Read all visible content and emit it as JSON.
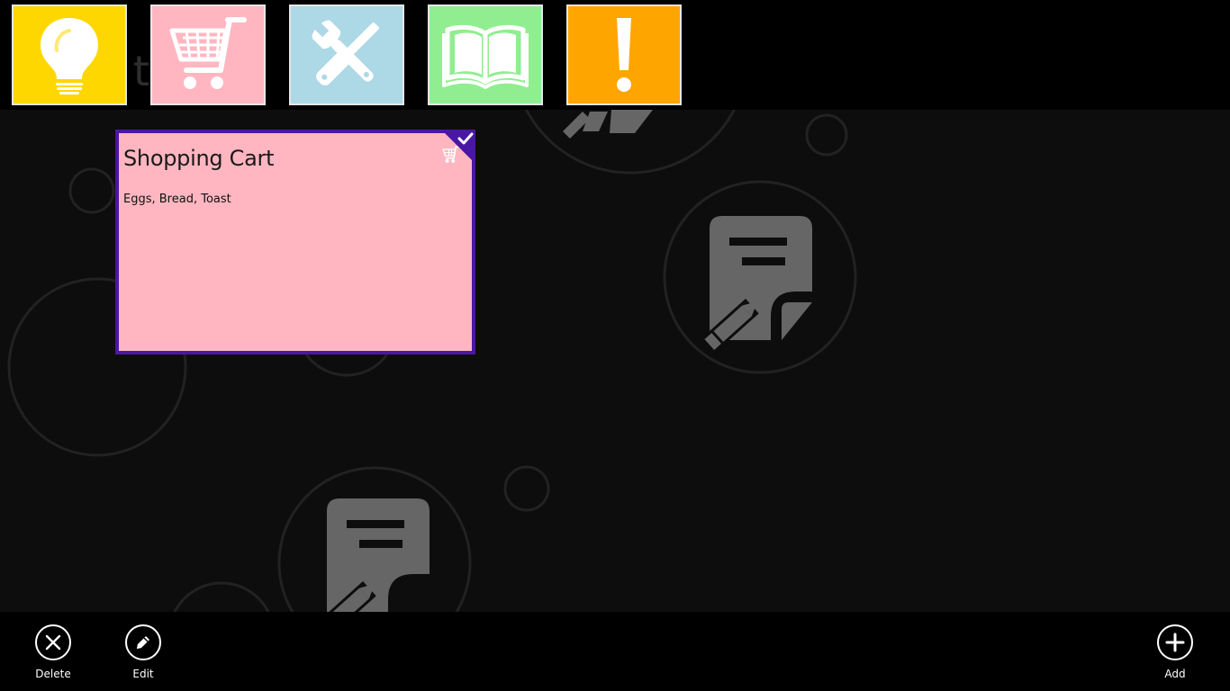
{
  "categories": [
    {
      "id": "idea",
      "icon": "lightbulb-icon",
      "color": "#ffd700"
    },
    {
      "id": "shopping",
      "icon": "shopping-cart-icon",
      "color": "#ffb6c1"
    },
    {
      "id": "tools",
      "icon": "tools-icon",
      "color": "#add8e6"
    },
    {
      "id": "reading",
      "icon": "open-book-icon",
      "color": "#90ee90"
    },
    {
      "id": "important",
      "icon": "exclamation-icon",
      "color": "#ffa500"
    }
  ],
  "note": {
    "title": "Shopping Cart",
    "body": "Eggs, Bread, Toast",
    "icon": "shopping-cart-icon",
    "color": "#ffb6c1",
    "selected": true,
    "selection_color": "#4a17a5"
  },
  "appbar": {
    "delete_label": "Delete",
    "edit_label": "Edit",
    "add_label": "Add"
  }
}
